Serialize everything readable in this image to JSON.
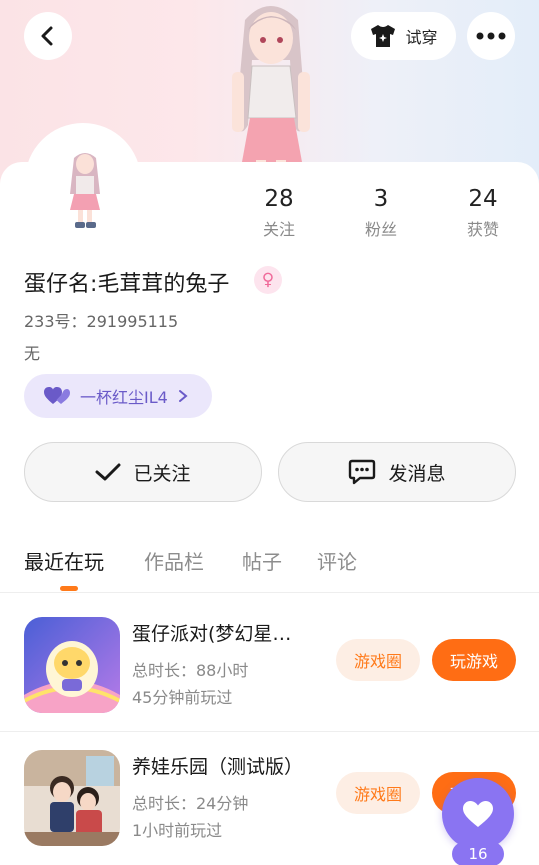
{
  "header": {
    "tryon_label": "试穿"
  },
  "stats": [
    {
      "value": "28",
      "label": "关注"
    },
    {
      "value": "3",
      "label": "粉丝"
    },
    {
      "value": "24",
      "label": "获赞"
    }
  ],
  "profile": {
    "nickname": "蛋仔名:毛茸茸的兔子",
    "gender_symbol": "♀",
    "uid": "233号：291995115",
    "bio": "无",
    "fan_badge": "一杯红尘IL4"
  },
  "actions": {
    "follow_label": "已关注",
    "message_label": "发消息"
  },
  "tabs": [
    {
      "label": "最近在玩",
      "active": true
    },
    {
      "label": "作品栏",
      "active": false
    },
    {
      "label": "帖子",
      "active": false
    },
    {
      "label": "评论",
      "active": false
    }
  ],
  "games": [
    {
      "name": "蛋仔派对(梦幻星…",
      "duration": "总时长：88小时",
      "last_played": "45分钟前玩过",
      "circle_label": "游戏圈",
      "play_label": "玩游戏"
    },
    {
      "name": "养娃乐园（测试版）",
      "duration": "总时长：24分钟",
      "last_played": "1小时前玩过",
      "circle_label": "游戏圈",
      "play_label": "玩游戏"
    }
  ],
  "float_like": {
    "count": "16"
  },
  "colors": {
    "accent_orange": "#ff6d14",
    "accent_purple": "#8a74f2",
    "badge_purple": "#6a5ac8"
  }
}
